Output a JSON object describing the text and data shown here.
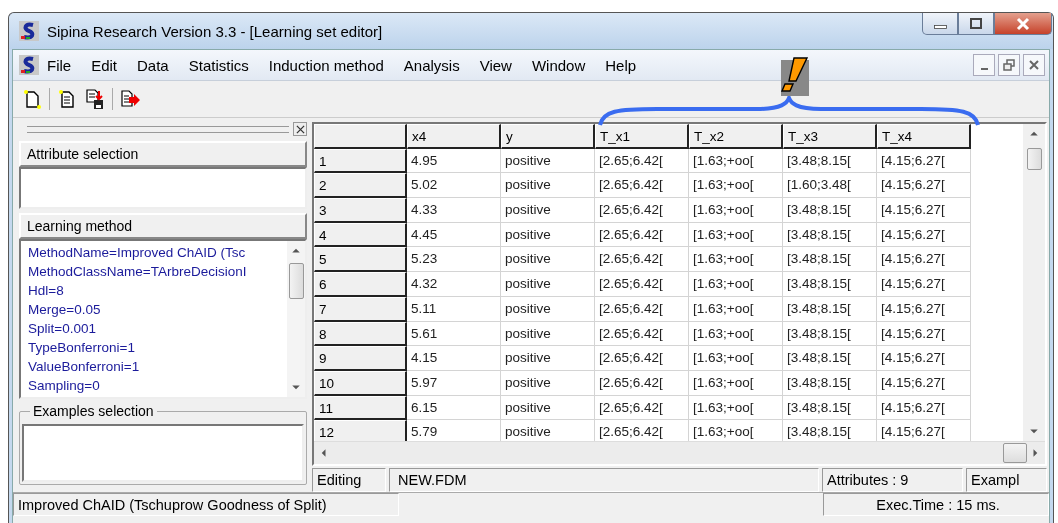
{
  "window": {
    "title": "Sipina Research Version 3.3 - [Learning set editor]"
  },
  "menu": [
    "File",
    "Edit",
    "Data",
    "Statistics",
    "Induction method",
    "Analysis",
    "View",
    "Window",
    "Help"
  ],
  "left_panel": {
    "attribute_selection": {
      "title": "Attribute selection"
    },
    "learning_method": {
      "title": "Learning method",
      "lines": [
        "MethodName=Improved ChAID (Tsc",
        "MethodClassName=TArbreDecisionI",
        "Hdl=8",
        "Merge=0.05",
        "Split=0.001",
        "TypeBonferroni=1",
        "ValueBonferroni=1",
        "Sampling=0"
      ]
    },
    "examples_selection": {
      "title": "Examples selection"
    }
  },
  "table": {
    "columns": [
      "x4",
      "y",
      "T_x1",
      "T_x2",
      "T_x3",
      "T_x4"
    ],
    "rows": [
      {
        "index": "1",
        "cells": [
          "4.95",
          "positive",
          "[2.65;6.42[",
          "[1.63;+oo[",
          "[3.48;8.15[",
          "[4.15;6.27["
        ]
      },
      {
        "index": "2",
        "cells": [
          "5.02",
          "positive",
          "[2.65;6.42[",
          "[1.63;+oo[",
          "[1.60;3.48[",
          "[4.15;6.27["
        ]
      },
      {
        "index": "3",
        "cells": [
          "4.33",
          "positive",
          "[2.65;6.42[",
          "[1.63;+oo[",
          "[3.48;8.15[",
          "[4.15;6.27["
        ]
      },
      {
        "index": "4",
        "cells": [
          "4.45",
          "positive",
          "[2.65;6.42[",
          "[1.63;+oo[",
          "[3.48;8.15[",
          "[4.15;6.27["
        ]
      },
      {
        "index": "5",
        "cells": [
          "5.23",
          "positive",
          "[2.65;6.42[",
          "[1.63;+oo[",
          "[3.48;8.15[",
          "[4.15;6.27["
        ]
      },
      {
        "index": "6",
        "cells": [
          "4.32",
          "positive",
          "[2.65;6.42[",
          "[1.63;+oo[",
          "[3.48;8.15[",
          "[4.15;6.27["
        ]
      },
      {
        "index": "7",
        "cells": [
          "5.11",
          "positive",
          "[2.65;6.42[",
          "[1.63;+oo[",
          "[3.48;8.15[",
          "[4.15;6.27["
        ]
      },
      {
        "index": "8",
        "cells": [
          "5.61",
          "positive",
          "[2.65;6.42[",
          "[1.63;+oo[",
          "[3.48;8.15[",
          "[4.15;6.27["
        ]
      },
      {
        "index": "9",
        "cells": [
          "4.15",
          "positive",
          "[2.65;6.42[",
          "[1.63;+oo[",
          "[3.48;8.15[",
          "[4.15;6.27["
        ]
      },
      {
        "index": "10",
        "cells": [
          "5.97",
          "positive",
          "[2.65;6.42[",
          "[1.63;+oo[",
          "[3.48;8.15[",
          "[4.15;6.27["
        ]
      },
      {
        "index": "11",
        "cells": [
          "6.15",
          "positive",
          "[2.65;6.42[",
          "[1.63;+oo[",
          "[3.48;8.15[",
          "[4.15;6.27["
        ]
      },
      {
        "index": "12",
        "cells": [
          "5.79",
          "positive",
          "[2.65;6.42[",
          "[1.63;+oo[",
          "[3.48;8.15[",
          "[4.15;6.27["
        ]
      }
    ]
  },
  "grid_status": [
    "Editing",
    "NEW.FDM",
    "Attributes : 9",
    "Exampl"
  ],
  "status_bar": [
    "Improved ChAID (Tschuprow Goodness of Split)",
    "Exec.Time : 15 ms."
  ]
}
